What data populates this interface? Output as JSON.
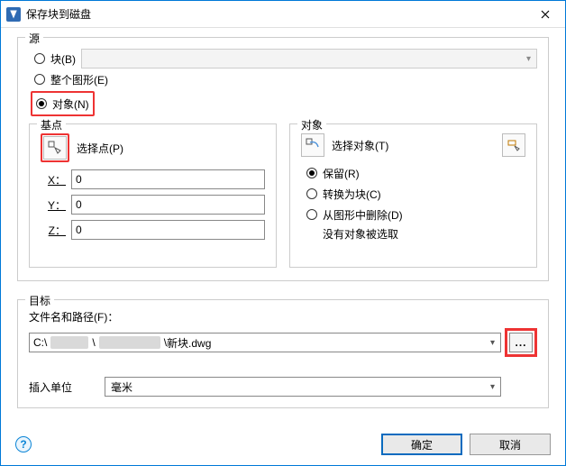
{
  "window": {
    "title": "保存块到磁盘"
  },
  "source": {
    "legend": "源",
    "block": {
      "label": "块(B)",
      "checked": false
    },
    "entire": {
      "label": "整个图形(E)",
      "checked": false
    },
    "objects": {
      "label": "对象(N)",
      "checked": true
    }
  },
  "basepoint": {
    "legend": "基点",
    "pick_label": "选择点(P)",
    "x_label": "X：",
    "x": "0",
    "y_label": "Y：",
    "y": "0",
    "z_label": "Z：",
    "z": "0"
  },
  "object": {
    "legend": "对象",
    "pick_label": "选择对象(T)",
    "retain": {
      "label": "保留(R)",
      "checked": true
    },
    "convert": {
      "label": "转换为块(C)",
      "checked": false
    },
    "delete": {
      "label": "从图形中删除(D)",
      "checked": false
    },
    "note": "没有对象被选取"
  },
  "target": {
    "legend": "目标",
    "path_label": "文件名和路径(F)：",
    "path_prefix": "C:\\",
    "path_suffix": "新块.dwg",
    "browse": "...",
    "units_label": "插入单位",
    "units_value": "毫米"
  },
  "footer": {
    "help": "?",
    "ok": "确定",
    "cancel": "取消"
  }
}
